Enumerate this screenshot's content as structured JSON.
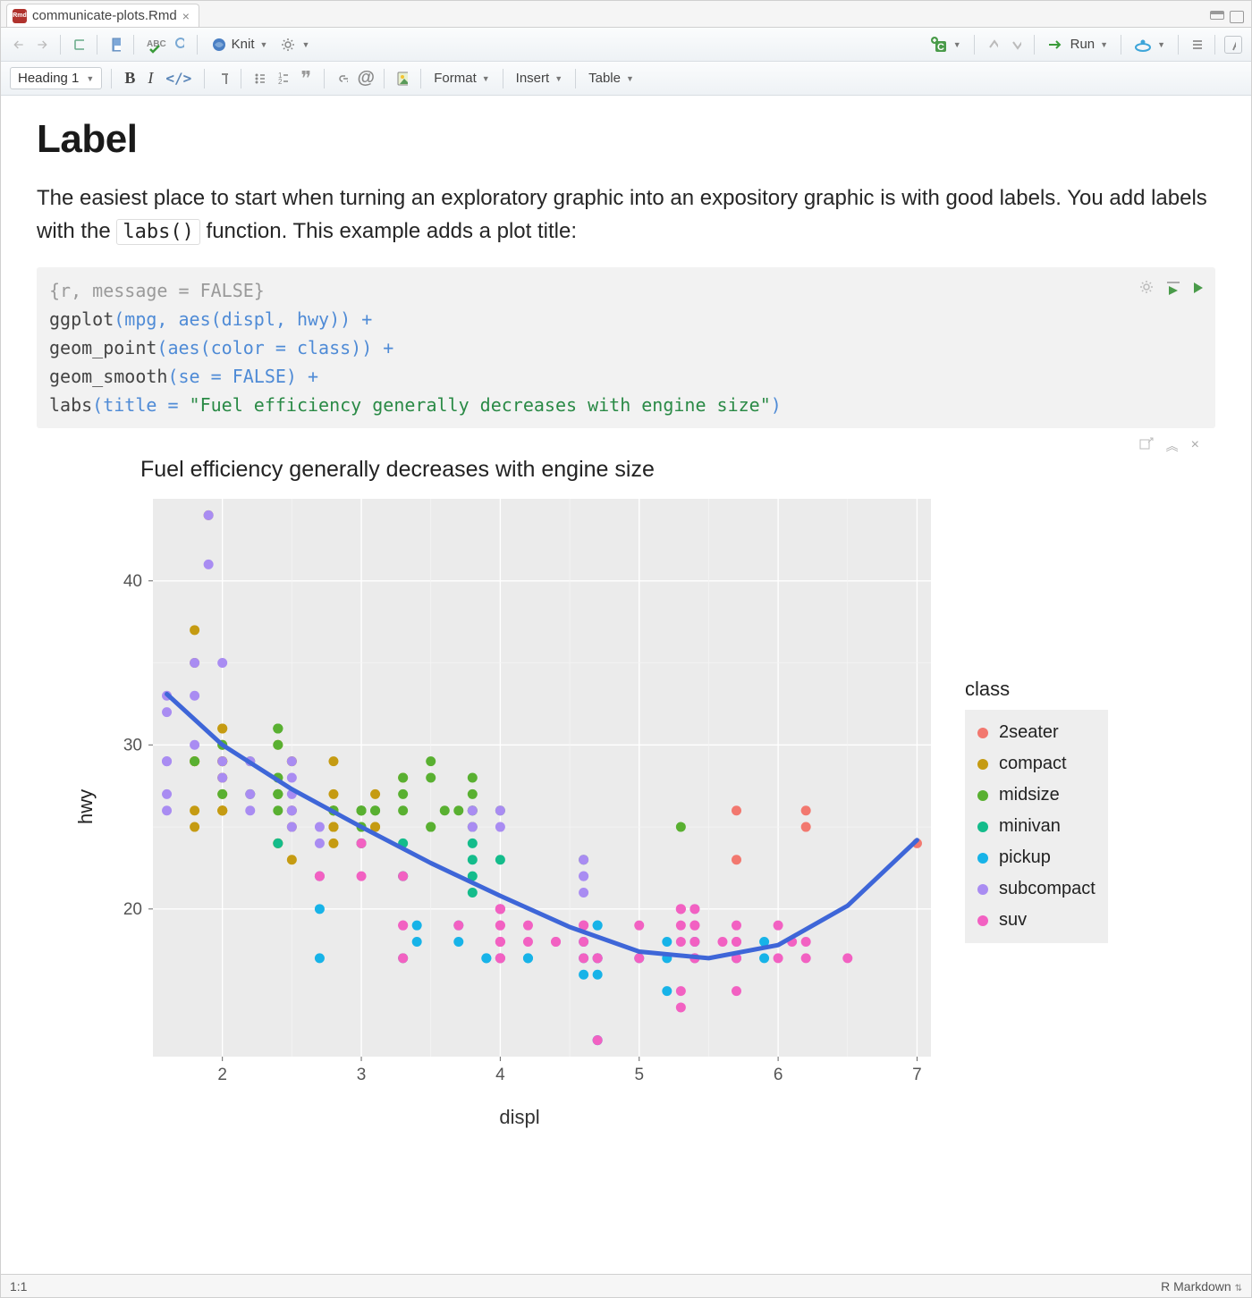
{
  "tab": {
    "filename": "communicate-plots.Rmd"
  },
  "toolbar1": {
    "knit_label": "Knit",
    "run_label": "Run"
  },
  "toolbar2": {
    "style": "Heading 1",
    "format_label": "Format",
    "insert_label": "Insert",
    "table_label": "Table"
  },
  "doc": {
    "heading": "Label",
    "para_before": "The easiest place to start when turning an exploratory graphic into an expository graphic is with good labels. You add labels with the ",
    "inline_code": "labs()",
    "para_after": " function. This example adds a plot title:"
  },
  "code": {
    "header": "{r, message = FALSE}",
    "l1_a": "ggplot",
    "l1_b": "(mpg, aes(displ, hwy)) +",
    "l2_a": "  geom_point",
    "l2_b": "(aes(color = class)) +",
    "l3_a": "  geom_smooth",
    "l3_b": "(se = ",
    "l3_c": "FALSE",
    "l3_d": ") +",
    "l4_a": "  labs",
    "l4_b": "(title = ",
    "l4_c": "\"Fuel efficiency generally decreases with engine size\"",
    "l4_d": ")"
  },
  "chart_data": {
    "type": "scatter",
    "title": "Fuel efficiency generally decreases with engine size",
    "xlabel": "displ",
    "ylabel": "hwy",
    "xlim": [
      1.5,
      7.1
    ],
    "ylim": [
      11,
      45
    ],
    "x_ticks": [
      2,
      3,
      4,
      5,
      6,
      7
    ],
    "y_ticks": [
      20,
      30,
      40
    ],
    "legend_title": "class",
    "class_colors": {
      "2seater": "#f2786f",
      "compact": "#c59b12",
      "midsize": "#59b031",
      "minivan": "#14bc8b",
      "pickup": "#17b3e8",
      "subcompact": "#a98cf2",
      "suv": "#f261c2"
    },
    "series": [
      {
        "name": "2seater",
        "color": "#f2786f",
        "points": [
          [
            5.7,
            26
          ],
          [
            5.7,
            23
          ],
          [
            6.2,
            26
          ],
          [
            6.2,
            25
          ],
          [
            7.0,
            24
          ]
        ]
      },
      {
        "name": "compact",
        "color": "#c59b12",
        "points": [
          [
            1.8,
            29
          ],
          [
            1.8,
            29
          ],
          [
            2.0,
            31
          ],
          [
            2.0,
            30
          ],
          [
            2.8,
            26
          ],
          [
            2.8,
            26
          ],
          [
            3.1,
            27
          ],
          [
            1.8,
            26
          ],
          [
            1.8,
            25
          ],
          [
            2.0,
            28
          ],
          [
            2.0,
            27
          ],
          [
            2.8,
            25
          ],
          [
            2.8,
            25
          ],
          [
            3.1,
            25
          ],
          [
            3.1,
            25
          ],
          [
            2.4,
            24
          ],
          [
            2.4,
            24
          ],
          [
            2.5,
            26
          ],
          [
            2.5,
            23
          ],
          [
            3.3,
            28
          ],
          [
            2.0,
            26
          ],
          [
            2.0,
            29
          ],
          [
            2.0,
            29
          ],
          [
            2.0,
            29
          ],
          [
            2.0,
            28
          ],
          [
            2.0,
            29
          ],
          [
            2.0,
            26
          ],
          [
            2.4,
            27
          ],
          [
            2.4,
            30
          ],
          [
            2.5,
            26
          ],
          [
            2.5,
            25
          ],
          [
            2.8,
            27
          ],
          [
            2.8,
            25
          ],
          [
            1.8,
            35
          ],
          [
            1.8,
            37
          ],
          [
            2.0,
            31
          ],
          [
            2.0,
            26
          ],
          [
            2.8,
            26
          ],
          [
            2.8,
            29
          ],
          [
            1.9,
            44
          ],
          [
            2.0,
            29
          ],
          [
            2.0,
            26
          ],
          [
            2.5,
            29
          ],
          [
            2.5,
            29
          ],
          [
            1.8,
            29
          ],
          [
            1.8,
            29
          ],
          [
            2.8,
            24
          ]
        ]
      },
      {
        "name": "midsize",
        "color": "#59b031",
        "points": [
          [
            2.4,
            31
          ],
          [
            2.4,
            30
          ],
          [
            3.1,
            26
          ],
          [
            3.5,
            29
          ],
          [
            3.6,
            26
          ],
          [
            2.4,
            26
          ],
          [
            2.4,
            27
          ],
          [
            3.3,
            26
          ],
          [
            2.4,
            27
          ],
          [
            2.4,
            27
          ],
          [
            2.4,
            28
          ],
          [
            2.4,
            28
          ],
          [
            3.8,
            26
          ],
          [
            3.8,
            26
          ],
          [
            3.8,
            27
          ],
          [
            3.8,
            28
          ],
          [
            3.8,
            25
          ],
          [
            5.3,
            25
          ],
          [
            2.2,
            27
          ],
          [
            2.2,
            29
          ],
          [
            2.4,
            31
          ],
          [
            2.4,
            31
          ],
          [
            3.0,
            26
          ],
          [
            3.0,
            26
          ],
          [
            3.5,
            28
          ],
          [
            1.8,
            29
          ],
          [
            2.0,
            27
          ],
          [
            2.0,
            30
          ],
          [
            2.8,
            26
          ],
          [
            2.8,
            26
          ],
          [
            3.1,
            26
          ],
          [
            3.0,
            26
          ],
          [
            3.7,
            26
          ],
          [
            3.0,
            25
          ],
          [
            3.0,
            24
          ],
          [
            3.5,
            25
          ],
          [
            3.5,
            25
          ],
          [
            3.0,
            26
          ],
          [
            3.3,
            28
          ],
          [
            3.3,
            27
          ],
          [
            4.0,
            26
          ],
          [
            4.6,
            23
          ]
        ]
      },
      {
        "name": "minivan",
        "color": "#14bc8b",
        "points": [
          [
            2.4,
            24
          ],
          [
            3.0,
            24
          ],
          [
            3.3,
            22
          ],
          [
            3.3,
            22
          ],
          [
            3.3,
            24
          ],
          [
            3.8,
            22
          ],
          [
            3.8,
            21
          ],
          [
            3.8,
            23
          ],
          [
            4.0,
            23
          ],
          [
            3.3,
            17
          ],
          [
            3.8,
            24
          ]
        ]
      },
      {
        "name": "pickup",
        "color": "#17b3e8",
        "points": [
          [
            3.7,
            19
          ],
          [
            3.7,
            18
          ],
          [
            3.9,
            17
          ],
          [
            3.9,
            17
          ],
          [
            4.7,
            19
          ],
          [
            4.7,
            19
          ],
          [
            4.7,
            12
          ],
          [
            5.2,
            17
          ],
          [
            5.2,
            15
          ],
          [
            5.9,
            17
          ],
          [
            4.7,
            17
          ],
          [
            4.7,
            17
          ],
          [
            4.7,
            16
          ],
          [
            5.2,
            18
          ],
          [
            5.7,
            17
          ],
          [
            5.9,
            18
          ],
          [
            4.2,
            17
          ],
          [
            4.2,
            17
          ],
          [
            4.6,
            17
          ],
          [
            4.6,
            16
          ],
          [
            4.6,
            18
          ],
          [
            5.4,
            17
          ],
          [
            5.4,
            18
          ],
          [
            2.7,
            20
          ],
          [
            2.7,
            22
          ],
          [
            2.7,
            17
          ],
          [
            3.4,
            19
          ],
          [
            3.4,
            18
          ],
          [
            4.0,
            20
          ],
          [
            4.0,
            17
          ],
          [
            4.7,
            17
          ],
          [
            4.7,
            12
          ],
          [
            5.0,
            17
          ]
        ]
      },
      {
        "name": "subcompact",
        "color": "#a98cf2",
        "points": [
          [
            3.8,
            26
          ],
          [
            3.8,
            25
          ],
          [
            4.0,
            26
          ],
          [
            4.0,
            25
          ],
          [
            4.6,
            23
          ],
          [
            4.6,
            22
          ],
          [
            4.6,
            22
          ],
          [
            4.6,
            21
          ],
          [
            5.4,
            20
          ],
          [
            1.6,
            33
          ],
          [
            1.6,
            32
          ],
          [
            1.6,
            29
          ],
          [
            1.6,
            27
          ],
          [
            1.6,
            26
          ],
          [
            1.8,
            30
          ],
          [
            1.8,
            33
          ],
          [
            1.8,
            35
          ],
          [
            2.0,
            35
          ],
          [
            1.6,
            29
          ],
          [
            1.6,
            29
          ],
          [
            2.5,
            28
          ],
          [
            2.5,
            26
          ],
          [
            2.5,
            26
          ],
          [
            2.2,
            29
          ],
          [
            2.2,
            27
          ],
          [
            2.5,
            25
          ],
          [
            2.5,
            27
          ],
          [
            1.9,
            41
          ],
          [
            1.9,
            44
          ],
          [
            2.0,
            29
          ],
          [
            2.5,
            29
          ],
          [
            2.0,
            28
          ],
          [
            2.7,
            24
          ],
          [
            2.7,
            25
          ],
          [
            2.2,
            26
          ]
        ]
      },
      {
        "name": "suv",
        "color": "#f261c2",
        "points": [
          [
            5.3,
            20
          ],
          [
            5.3,
            15
          ],
          [
            5.3,
            20
          ],
          [
            5.7,
            17
          ],
          [
            6.0,
            17
          ],
          [
            5.7,
            18
          ],
          [
            5.7,
            17
          ],
          [
            6.2,
            18
          ],
          [
            6.2,
            17
          ],
          [
            5.3,
            19
          ],
          [
            5.3,
            14
          ],
          [
            5.7,
            15
          ],
          [
            6.5,
            17
          ],
          [
            2.7,
            22
          ],
          [
            2.7,
            22
          ],
          [
            4.0,
            17
          ],
          [
            4.0,
            20
          ],
          [
            4.0,
            19
          ],
          [
            4.0,
            20
          ],
          [
            4.0,
            17
          ],
          [
            4.2,
            19
          ],
          [
            4.4,
            18
          ],
          [
            4.6,
            19
          ],
          [
            5.4,
            17
          ],
          [
            5.4,
            17
          ],
          [
            5.4,
            18
          ],
          [
            4.0,
            17
          ],
          [
            4.0,
            19
          ],
          [
            4.6,
            19
          ],
          [
            5.0,
            17
          ],
          [
            3.0,
            22
          ],
          [
            3.7,
            19
          ],
          [
            4.0,
            20
          ],
          [
            4.7,
            17
          ],
          [
            4.7,
            12
          ],
          [
            4.7,
            17
          ],
          [
            5.7,
            18
          ],
          [
            6.1,
            18
          ],
          [
            4.0,
            18
          ],
          [
            4.2,
            18
          ],
          [
            4.4,
            18
          ],
          [
            4.6,
            18
          ],
          [
            5.4,
            19
          ],
          [
            5.4,
            19
          ],
          [
            5.4,
            20
          ],
          [
            4.0,
            18
          ],
          [
            4.0,
            18
          ],
          [
            4.6,
            17
          ],
          [
            5.0,
            19
          ],
          [
            3.3,
            17
          ],
          [
            3.3,
            19
          ],
          [
            4.0,
            20
          ],
          [
            5.6,
            18
          ],
          [
            3.0,
            24
          ],
          [
            3.3,
            22
          ],
          [
            3.3,
            19
          ],
          [
            4.0,
            18
          ],
          [
            5.3,
            18
          ],
          [
            5.3,
            20
          ],
          [
            5.7,
            19
          ],
          [
            6.0,
            19
          ]
        ]
      }
    ],
    "smooth_line": [
      [
        1.6,
        33.1
      ],
      [
        2.0,
        30.0
      ],
      [
        2.5,
        27.3
      ],
      [
        3.0,
        25.0
      ],
      [
        3.5,
        22.8
      ],
      [
        4.0,
        20.8
      ],
      [
        4.5,
        18.9
      ],
      [
        5.0,
        17.4
      ],
      [
        5.5,
        17.0
      ],
      [
        6.0,
        17.8
      ],
      [
        6.5,
        20.2
      ],
      [
        7.0,
        24.2
      ]
    ]
  },
  "status": {
    "pos": "1:1",
    "mode": "R Markdown"
  }
}
